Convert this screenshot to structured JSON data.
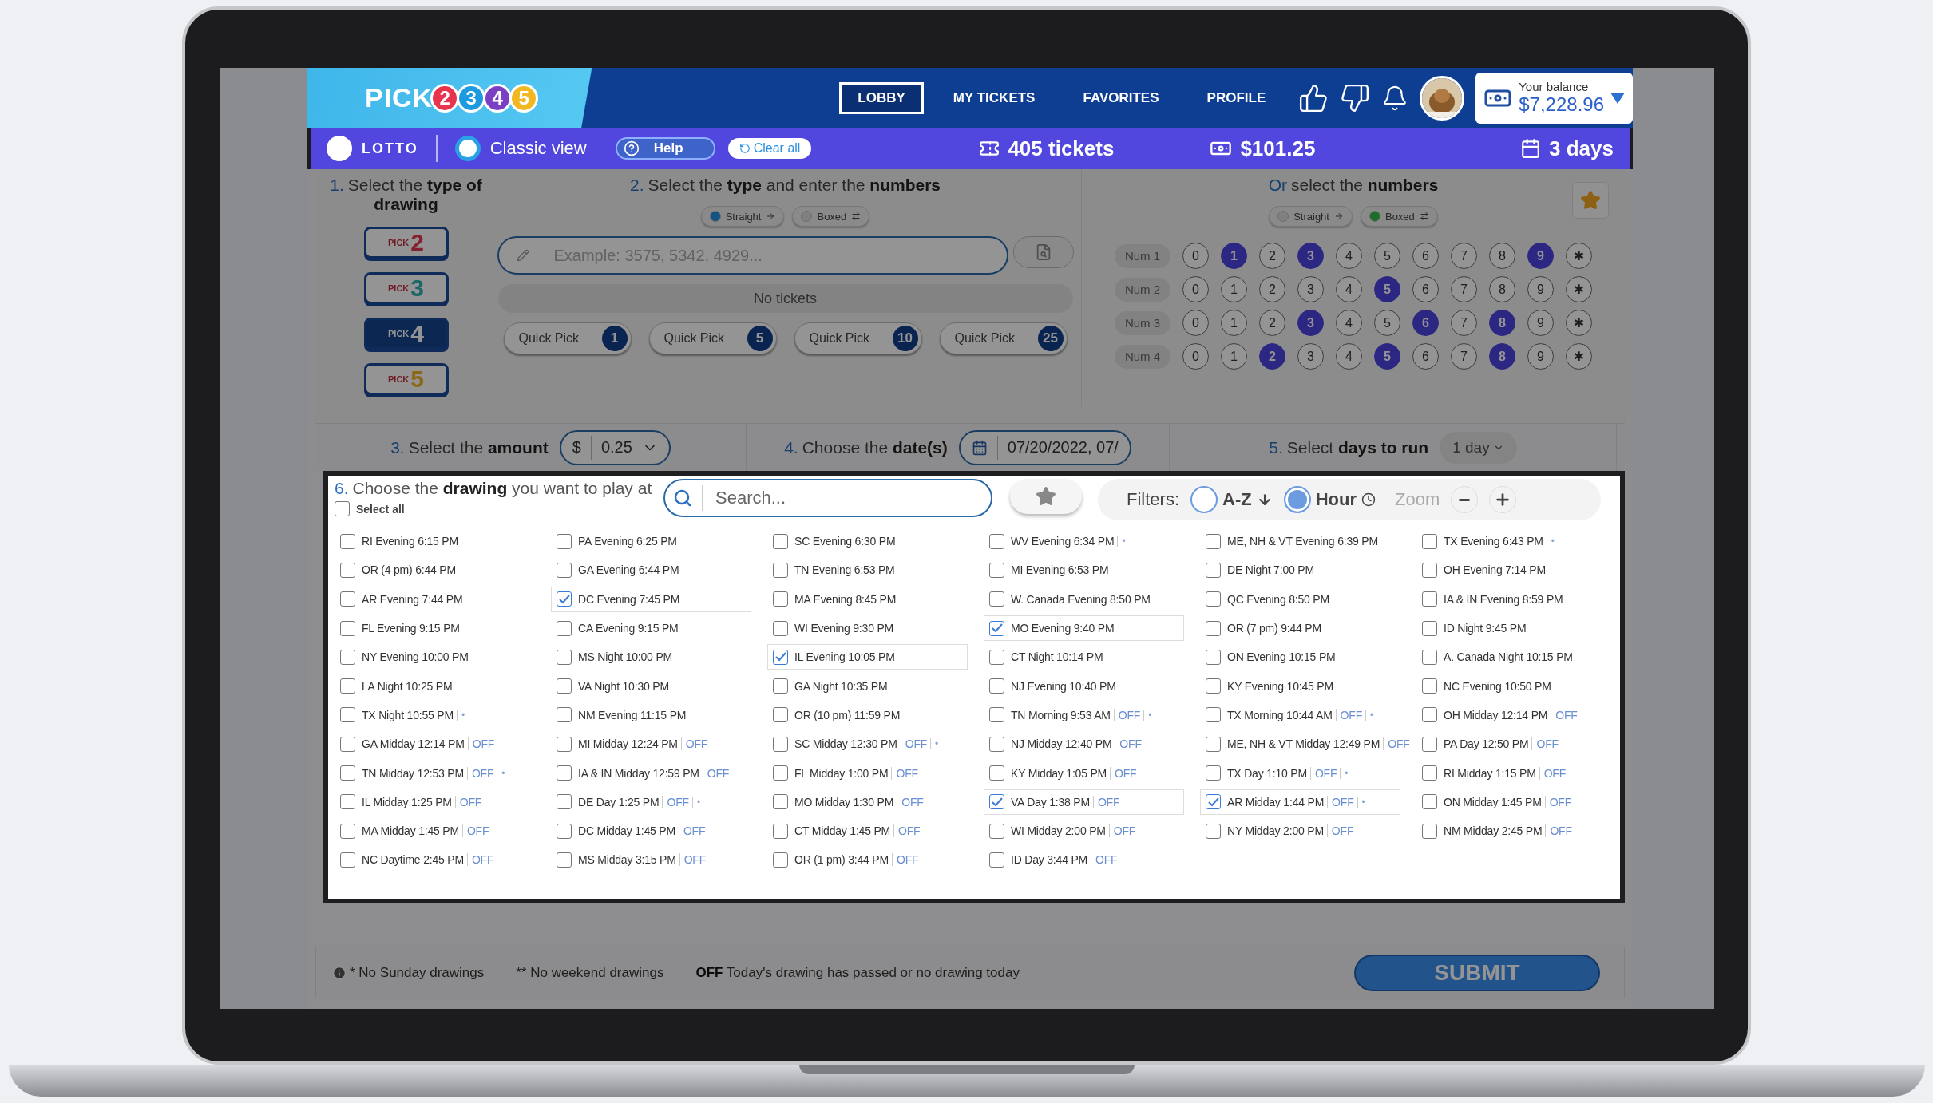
{
  "logo": {
    "word": "PICK",
    "digits": [
      {
        "label": "2",
        "color": "#e8344e"
      },
      {
        "label": "3",
        "color": "#1e9be0"
      },
      {
        "label": "4",
        "color": "#7b3fc4"
      },
      {
        "label": "5",
        "color": "#f2b822"
      }
    ]
  },
  "nav": [
    {
      "label": "LOBBY",
      "selected": true
    },
    {
      "label": "MY TICKETS",
      "selected": false
    },
    {
      "label": "FAVORITES",
      "selected": false
    },
    {
      "label": "PROFILE",
      "selected": false
    }
  ],
  "balance": {
    "label": "Your balance",
    "amount": "$7,228.96"
  },
  "toolbar": {
    "lotto": "LOTTO",
    "classic_view": "Classic view",
    "help": "Help",
    "clear": "Clear all",
    "tickets": "405 tickets",
    "total": "$101.25",
    "days": "3 days"
  },
  "step1": {
    "number": "1.",
    "title": "Select the **type of drawing**",
    "games": [
      {
        "word": "PICK",
        "digit": "2",
        "color": "#83222e",
        "selected": false
      },
      {
        "word": "PICK",
        "digit": "3",
        "color": "#196866",
        "selected": false
      },
      {
        "word": "PICK",
        "digit": "4",
        "selected": true
      },
      {
        "word": "PICK",
        "digit": "5",
        "color": "#8b6814",
        "selected": false
      }
    ]
  },
  "step2": {
    "number": "2.",
    "title": "Select the **type** and enter the **numbers**",
    "modes": [
      {
        "label": "Straight",
        "selected": true
      },
      {
        "label": "Boxed",
        "selected": false
      }
    ],
    "input": {
      "placeholder": "Example: 3575, 5342, 4929..."
    },
    "tickets_status": "No tickets",
    "quick_picks": [
      {
        "label": "Quick Pick",
        "count": "1"
      },
      {
        "label": "Quick Pick",
        "count": "5"
      },
      {
        "label": "Quick Pick",
        "count": "10"
      },
      {
        "label": "Quick Pick",
        "count": "25"
      }
    ]
  },
  "numbers": {
    "prefix": "Or",
    "title": "select the **numbers**",
    "modes": [
      {
        "label": "Straight",
        "selected": false
      },
      {
        "label": "Boxed",
        "selected": true
      }
    ],
    "rows": [
      {
        "label": "Num 1",
        "cells": [
          {
            "label": "0",
            "selected": false
          },
          {
            "label": "1",
            "selected": true
          },
          {
            "label": "2",
            "selected": false
          },
          {
            "label": "3",
            "selected": true
          },
          {
            "label": "4",
            "selected": false
          },
          {
            "label": "5",
            "selected": false
          },
          {
            "label": "6",
            "selected": false
          },
          {
            "label": "7",
            "selected": false
          },
          {
            "label": "8",
            "selected": false
          },
          {
            "label": "9",
            "selected": true
          },
          {
            "label": "✱",
            "selected": false
          }
        ]
      },
      {
        "label": "Num 2",
        "cells": [
          {
            "label": "0",
            "selected": false
          },
          {
            "label": "1",
            "selected": false
          },
          {
            "label": "2",
            "selected": false
          },
          {
            "label": "3",
            "selected": false
          },
          {
            "label": "4",
            "selected": false
          },
          {
            "label": "5",
            "selected": true
          },
          {
            "label": "6",
            "selected": false
          },
          {
            "label": "7",
            "selected": false
          },
          {
            "label": "8",
            "selected": false
          },
          {
            "label": "9",
            "selected": false
          },
          {
            "label": "✱",
            "selected": false
          }
        ]
      },
      {
        "label": "Num 3",
        "cells": [
          {
            "label": "0",
            "selected": false
          },
          {
            "label": "1",
            "selected": false
          },
          {
            "label": "2",
            "selected": false
          },
          {
            "label": "3",
            "selected": true
          },
          {
            "label": "4",
            "selected": false
          },
          {
            "label": "5",
            "selected": false
          },
          {
            "label": "6",
            "selected": true
          },
          {
            "label": "7",
            "selected": false
          },
          {
            "label": "8",
            "selected": true
          },
          {
            "label": "9",
            "selected": false
          },
          {
            "label": "✱",
            "selected": false
          }
        ]
      },
      {
        "label": "Num 4",
        "cells": [
          {
            "label": "0",
            "selected": false
          },
          {
            "label": "1",
            "selected": false
          },
          {
            "label": "2",
            "selected": true
          },
          {
            "label": "3",
            "selected": false
          },
          {
            "label": "4",
            "selected": false
          },
          {
            "label": "5",
            "selected": true
          },
          {
            "label": "6",
            "selected": false
          },
          {
            "label": "7",
            "selected": false
          },
          {
            "label": "8",
            "selected": true
          },
          {
            "label": "9",
            "selected": false
          },
          {
            "label": "✱",
            "selected": false
          }
        ]
      }
    ]
  },
  "amount": {
    "number": "3.",
    "title": "Select the **amount**",
    "currency": "$",
    "value": "0.25"
  },
  "dates": {
    "number": "4.",
    "title": "Choose the **date(s)**",
    "value": "07/20/2022, 07/"
  },
  "days": {
    "number": "5.",
    "title": "Select **days to run**",
    "value": "1 day"
  },
  "drawings": {
    "number": "6.",
    "title": "Choose the **drawing** you want to play at",
    "select_all": {
      "label": "Select all",
      "checked": false
    },
    "search": {
      "placeholder": "Search..."
    },
    "filters_label": "Filters:",
    "sorts": [
      {
        "label": "A-Z",
        "selected": false
      },
      {
        "label": "Hour",
        "selected": true
      }
    ],
    "zoom_label": "Zoom",
    "items": [
      {
        "label": "RI Evening 6:15 PM",
        "checked": false
      },
      {
        "label": "PA Evening 6:25 PM",
        "checked": false
      },
      {
        "label": "SC Evening 6:30 PM",
        "checked": false
      },
      {
        "label": "WV Evening 6:34 PM",
        "note": "•",
        "checked": false
      },
      {
        "label": "ME, NH & VT Evening 6:39 PM",
        "checked": false
      },
      {
        "label": "TX Evening 6:43 PM",
        "note": "•",
        "checked": false
      },
      {
        "label": "OR (4 pm) 6:44 PM",
        "checked": false
      },
      {
        "label": "GA Evening 6:44 PM",
        "checked": false
      },
      {
        "label": "TN Evening 6:53 PM",
        "checked": false
      },
      {
        "label": "MI Evening 6:53 PM",
        "checked": false
      },
      {
        "label": "DE Night 7:00 PM",
        "checked": false
      },
      {
        "label": "OH Evening 7:14 PM",
        "checked": false
      },
      {
        "label": "AR Evening 7:44 PM",
        "checked": false
      },
      {
        "label": "DC Evening 7:45 PM",
        "checked": true
      },
      {
        "label": "MA Evening 8:45 PM",
        "checked": false
      },
      {
        "label": "W. Canada Evening 8:50 PM",
        "checked": false
      },
      {
        "label": "QC Evening 8:50 PM",
        "checked": false
      },
      {
        "label": "IA & IN Evening 8:59 PM",
        "checked": false
      },
      {
        "label": "FL Evening 9:15 PM",
        "checked": false
      },
      {
        "label": "CA Evening 9:15 PM",
        "checked": false
      },
      {
        "label": "WI Evening 9:30 PM",
        "checked": false
      },
      {
        "label": "MO Evening 9:40 PM",
        "checked": true
      },
      {
        "label": "OR (7 pm) 9:44 PM",
        "checked": false
      },
      {
        "label": "ID Night 9:45 PM",
        "checked": false
      },
      {
        "label": "NY Evening 10:00 PM",
        "checked": false
      },
      {
        "label": "MS Night 10:00 PM",
        "checked": false
      },
      {
        "label": "IL Evening 10:05 PM",
        "checked": true
      },
      {
        "label": "CT Night 10:14 PM",
        "checked": false
      },
      {
        "label": "ON Evening 10:15 PM",
        "checked": false
      },
      {
        "label": "A. Canada Night 10:15 PM",
        "checked": false
      },
      {
        "label": "LA Night 10:25 PM",
        "checked": false
      },
      {
        "label": "VA Night 10:30 PM",
        "checked": false
      },
      {
        "label": "GA Night 10:35 PM",
        "checked": false
      },
      {
        "label": "NJ Evening 10:40 PM",
        "checked": false
      },
      {
        "label": "KY Evening 10:45 PM",
        "checked": false
      },
      {
        "label": "NC Evening 10:50 PM",
        "checked": false
      },
      {
        "label": "TX Night 10:55 PM",
        "note": "•",
        "checked": false
      },
      {
        "label": "NM Evening 11:15 PM",
        "checked": false
      },
      {
        "label": "OR (10 pm) 11:59 PM",
        "checked": false
      },
      {
        "label": "TN Morning 9:53 AM",
        "off": "OFF",
        "note": "•",
        "checked": false
      },
      {
        "label": "TX Morning 10:44 AM",
        "off": "OFF",
        "note": "•",
        "checked": false
      },
      {
        "label": "OH Midday 12:14 PM",
        "off": "OFF",
        "checked": false
      },
      {
        "label": "GA Midday 12:14 PM",
        "off": "OFF",
        "checked": false
      },
      {
        "label": "MI Midday 12:24 PM",
        "off": "OFF",
        "checked": false
      },
      {
        "label": "SC Midday 12:30 PM",
        "off": "OFF",
        "note": "•",
        "checked": false
      },
      {
        "label": "NJ Midday 12:40 PM",
        "off": "OFF",
        "checked": false
      },
      {
        "label": "ME, NH & VT Midday 12:49 PM",
        "off": "OFF",
        "checked": false
      },
      {
        "label": "PA Day 12:50 PM",
        "off": "OFF",
        "checked": false
      },
      {
        "label": "TN Midday 12:53 PM",
        "off": "OFF",
        "note": "•",
        "checked": false
      },
      {
        "label": "IA & IN Midday 12:59 PM",
        "off": "OFF",
        "checked": false
      },
      {
        "label": "FL Midday 1:00 PM",
        "off": "OFF",
        "checked": false
      },
      {
        "label": "KY Midday 1:05 PM",
        "off": "OFF",
        "checked": false
      },
      {
        "label": "TX Day 1:10 PM",
        "off": "OFF",
        "note": "•",
        "checked": false
      },
      {
        "label": "RI Midday 1:15 PM",
        "off": "OFF",
        "checked": false
      },
      {
        "label": "IL Midday 1:25 PM",
        "off": "OFF",
        "checked": false
      },
      {
        "label": "DE Day 1:25 PM",
        "off": "OFF",
        "note": "•",
        "checked": false
      },
      {
        "label": "MO Midday 1:30 PM",
        "off": "OFF",
        "checked": false
      },
      {
        "label": "VA Day 1:38 PM",
        "off": "OFF",
        "checked": true
      },
      {
        "label": "AR Midday 1:44 PM",
        "off": "OFF",
        "note": "•",
        "checked": true
      },
      {
        "label": "ON Midday 1:45 PM",
        "off": "OFF",
        "checked": false
      },
      {
        "label": "MA Midday 1:45 PM",
        "off": "OFF",
        "checked": false
      },
      {
        "label": "DC Midday 1:45 PM",
        "off": "OFF",
        "checked": false
      },
      {
        "label": "CT Midday 1:45 PM",
        "off": "OFF",
        "checked": false
      },
      {
        "label": "WI Midday 2:00 PM",
        "off": "OFF",
        "checked": false
      },
      {
        "label": "NY Midday 2:00 PM",
        "off": "OFF",
        "checked": false
      },
      {
        "label": "NM Midday 2:45 PM",
        "off": "OFF",
        "checked": false
      },
      {
        "label": "NC Daytime 2:45 PM",
        "off": "OFF",
        "checked": false
      },
      {
        "label": "MS Midday 3:15 PM",
        "off": "OFF",
        "checked": false
      },
      {
        "label": "OR (1 pm) 3:44 PM",
        "off": "OFF",
        "checked": false
      },
      {
        "label": "ID Day 3:44 PM",
        "off": "OFF",
        "checked": false
      }
    ]
  },
  "footer": {
    "notes": [
      "* No Sunday drawings",
      "** No weekend drawings",
      "**OFF** Today's drawing has passed or no drawing today"
    ],
    "submit": "SUBMIT"
  }
}
